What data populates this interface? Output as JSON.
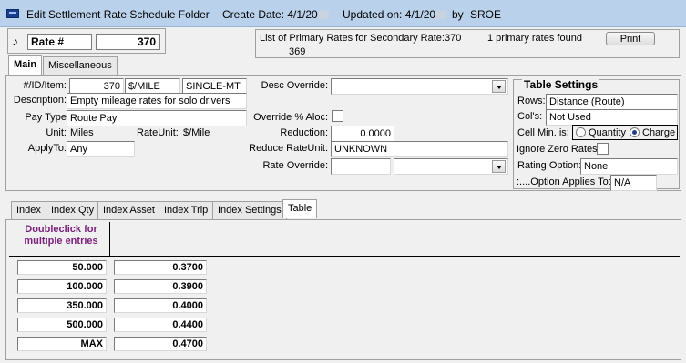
{
  "window": {
    "title": "Edit Settlement Rate Schedule Folder",
    "create_date_label": "Create Date: 4/1/20",
    "updated_label": "Updated on: 4/1/20",
    "by_label": "by",
    "user": "SROE"
  },
  "header": {
    "rate_label": "Rate #",
    "rate_number": "370",
    "primary_info": "List of Primary Rates for Secondary Rate:370",
    "found_text": "1 primary rates found",
    "primary_rate_value": "369",
    "print_label": "Print"
  },
  "top_tabs": [
    "Main",
    "Miscellaneous"
  ],
  "main": {
    "id_item_label": "#/ID/Item:",
    "id_value": "370",
    "unit_code": "$/MILE",
    "item_code": "SINGLE-MT",
    "description_label": "Description:",
    "description_value": "Empty mileage rates for solo drivers",
    "pay_type_label": "Pay Type",
    "pay_type_value": "Route Pay",
    "unit_label": "Unit:",
    "unit_value": "Miles",
    "rate_unit_label": "RateUnit:",
    "rate_unit_value": "$/Mile",
    "apply_to_label": "ApplyTo:",
    "apply_to_value": "Any",
    "desc_override_label": "Desc Override:",
    "desc_override_value": "",
    "override_aloc_label": "Override % Aloc:",
    "reduction_label": "Reduction:",
    "reduction_value": "0.0000",
    "reduce_rate_unit_label": "Reduce RateUnit:",
    "reduce_rate_unit_value": "UNKNOWN",
    "rate_override_label": "Rate Override:",
    "rate_override_value": "",
    "rate_override_select": ""
  },
  "table_settings": {
    "title": "Table Settings",
    "rows_label": "Rows:",
    "rows_value": "Distance (Route)",
    "cols_label": "Col's:",
    "cols_value": "Not Used",
    "cell_min_label": "Cell Min. is:",
    "radio_quantity": "Quantity",
    "radio_charge": "Charge",
    "cell_min_selected": "Charge",
    "ignore_zero_label": "Ignore Zero Rates",
    "rating_option_label": "Rating Option:",
    "rating_option_value": "None",
    "option_applies_label": ":....Option Applies To:",
    "option_applies_value": "N/A"
  },
  "bottom_tabs": [
    "Index",
    "Index Qty",
    "Index Asset",
    "Index Trip",
    "Index Settings",
    "Table"
  ],
  "table": {
    "corner_text": "Doubleclick for multiple entries",
    "rows": [
      {
        "row": "50.000",
        "rate": "0.3700"
      },
      {
        "row": "100.000",
        "rate": "0.3900"
      },
      {
        "row": "350.000",
        "rate": "0.4000"
      },
      {
        "row": "500.000",
        "rate": "0.4400"
      },
      {
        "row": "MAX",
        "rate": "0.4700"
      }
    ]
  },
  "colors": {
    "titlebar": "#b9d1ea",
    "corner_text": "#7a1f7a",
    "radio_selected": "#1f3f8a"
  }
}
